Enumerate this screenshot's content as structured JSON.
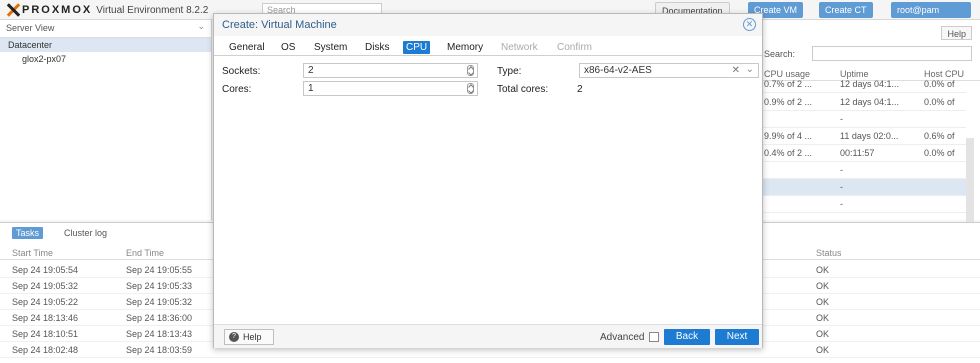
{
  "header": {
    "brand": "PROXMOX",
    "product": "Virtual Environment 8.2.2",
    "search_placeholder": "Search",
    "documentation": "Documentation",
    "create_vm": "Create VM",
    "create_ct": "Create CT",
    "user": "root@pam"
  },
  "tree": {
    "view": "Server View",
    "datacenter": "Datacenter",
    "node": "glox2-px07"
  },
  "grid": {
    "help": "Help",
    "search_label": "Search:",
    "columns": [
      "CPU usage",
      "Uptime",
      "Host CPU"
    ],
    "rows": [
      {
        "cpu": "0.7% of 2 ...",
        "uptime": "12 days 04:1...",
        "host": "0.0% of"
      },
      {
        "cpu": "0.9% of 2 ...",
        "uptime": "12 days 04:1...",
        "host": "0.0% of"
      },
      {
        "cpu": "",
        "uptime": "-",
        "host": ""
      },
      {
        "cpu": "9.9% of 4 ...",
        "uptime": "11 days 02:0...",
        "host": "0.6% of"
      },
      {
        "cpu": "0.4% of 2 ...",
        "uptime": "00:11:57",
        "host": "0.0% of"
      },
      {
        "cpu": "",
        "uptime": "-",
        "host": ""
      },
      {
        "cpu": "",
        "uptime": "-",
        "host": ""
      },
      {
        "cpu": "",
        "uptime": "-",
        "host": ""
      }
    ]
  },
  "tasks": {
    "tab_tasks": "Tasks",
    "tab_cluster": "Cluster log",
    "col_start": "Start Time",
    "col_end": "End Time",
    "col_status": "Status",
    "rows": [
      {
        "start": "Sep 24 19:05:54",
        "end": "Sep 24 19:05:55",
        "status": "OK"
      },
      {
        "start": "Sep 24 19:05:32",
        "end": "Sep 24 19:05:33",
        "status": "OK"
      },
      {
        "start": "Sep 24 19:05:22",
        "end": "Sep 24 19:05:32",
        "status": "OK"
      },
      {
        "start": "Sep 24 18:13:46",
        "end": "Sep 24 18:36:00",
        "status": "OK"
      },
      {
        "start": "Sep 24 18:10:51",
        "end": "Sep 24 18:13:43",
        "status": "OK"
      },
      {
        "start": "Sep 24 18:02:48",
        "end": "Sep 24 18:03:59",
        "status": "OK"
      }
    ]
  },
  "modal": {
    "title": "Create: Virtual Machine",
    "tabs": [
      "General",
      "OS",
      "System",
      "Disks",
      "CPU",
      "Memory",
      "Network",
      "Confirm"
    ],
    "sockets_label": "Sockets:",
    "sockets_value": "2",
    "cores_label": "Cores:",
    "cores_value": "1",
    "type_label": "Type:",
    "type_value": "x86-64-v2-AES",
    "total_cores_label": "Total cores:",
    "total_cores_value": "2",
    "help": "Help",
    "advanced": "Advanced",
    "back": "Back",
    "next": "Next"
  },
  "colors": {
    "accent": "#1d7bd2",
    "brand_orange": "#e57000"
  }
}
